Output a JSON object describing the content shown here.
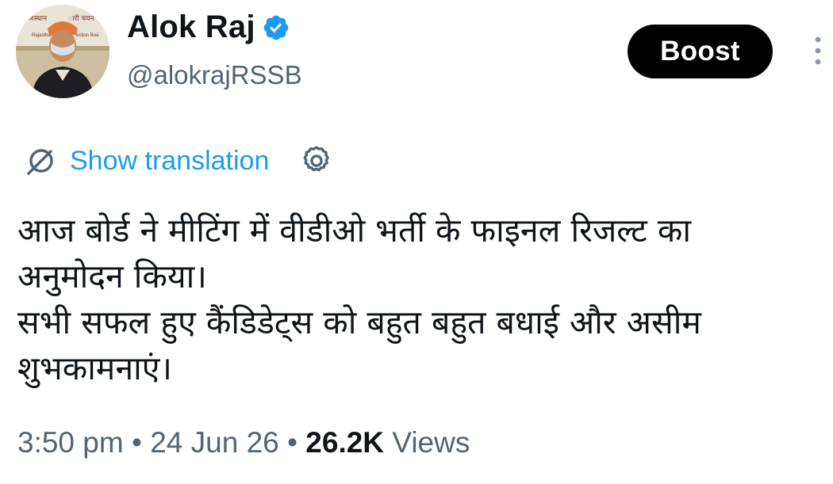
{
  "author": {
    "display_name": "Alok Raj",
    "handle": "@alokrajRSSB",
    "verified_icon": "verified-badge-icon",
    "avatar_banner_text": [
      "राजस्थान",
      "ारी चयन",
      "Rajasthan",
      "ection Boa"
    ]
  },
  "actions": {
    "boost_label": "Boost",
    "more_icon": "more-vertical-icon"
  },
  "translation": {
    "show_label": "Show translation",
    "translate_icon": "translate-icon",
    "settings_icon": "gear-icon"
  },
  "tweet": {
    "lines": [
      "आज बोर्ड ने मीटिंग में वीडीओ भर्ती के फाइनल रिजल्ट का",
      "अनुमोदन किया।",
      "सभी सफल हुए कैंडिडेट्स को बहुत बहुत बधाई और असीम",
      "शुभकामनाएं।"
    ]
  },
  "meta": {
    "time": "3:50 pm",
    "sep1": "•",
    "date": "24 Jun 26",
    "sep2": "•",
    "views_count": "26.2K",
    "views_label": "Views"
  },
  "colors": {
    "link_blue": "#1d9bf0",
    "muted_gray": "#536471",
    "text": "#0f1419",
    "button_bg": "#000000"
  }
}
